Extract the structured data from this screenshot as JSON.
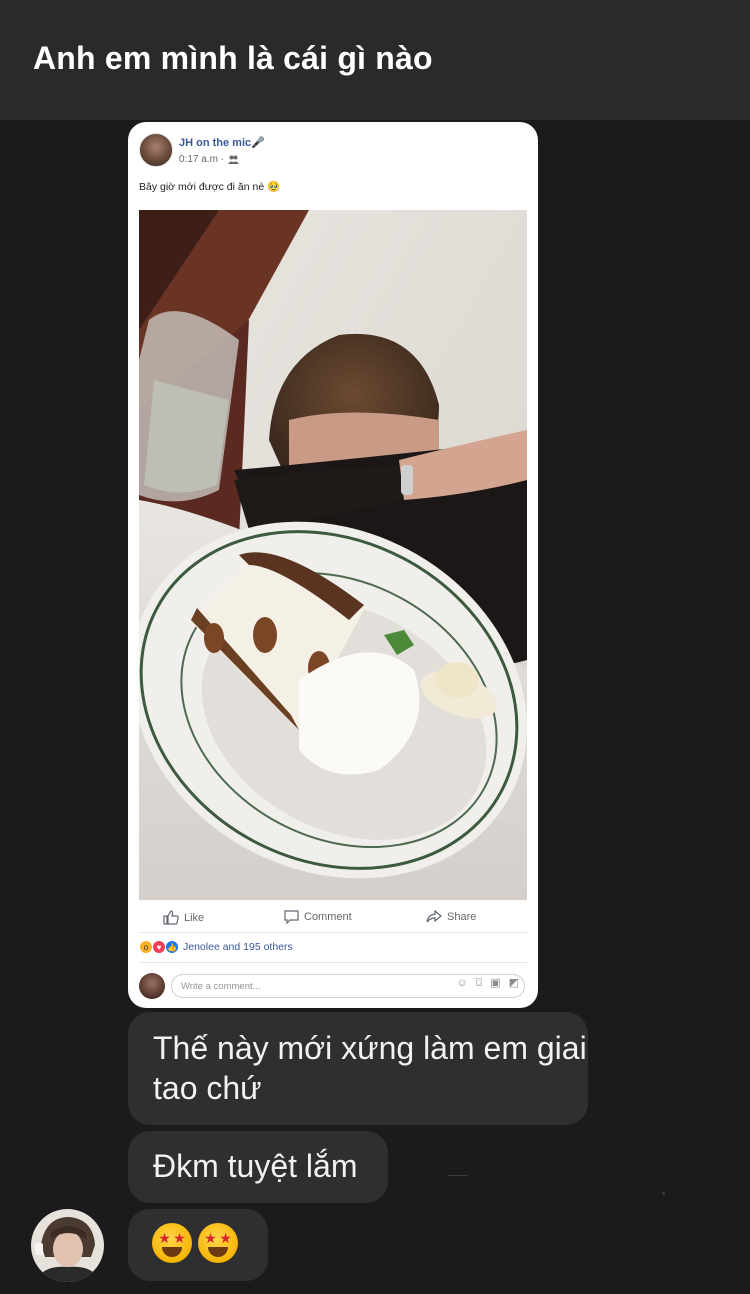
{
  "header": {
    "title": "Anh em mình là cái gì nào"
  },
  "post": {
    "author": "JH on the mic🎤",
    "time": "0:17 a.m ·",
    "audience_icon": "friends-icon",
    "caption": "Bây giờ mới được đi ăn nè 🥹",
    "actions": {
      "like": "Like",
      "comment": "Comment",
      "share": "Share"
    },
    "reactions": {
      "text": "Jenolee and 195 others",
      "types": [
        "wow",
        "love",
        "like"
      ]
    },
    "comment_placeholder": "Write a comment..."
  },
  "messages": [
    {
      "text": "Thế này mới xứng làm em giai tao chứ"
    },
    {
      "text": "Đkm tuyệt lắm"
    },
    {
      "emoji": [
        "star-struck",
        "star-struck"
      ]
    }
  ],
  "colors": {
    "background": "#1b1b1d",
    "header": "#2a2a2c",
    "bubble": "#2f2f31",
    "fb_link": "#385898"
  }
}
